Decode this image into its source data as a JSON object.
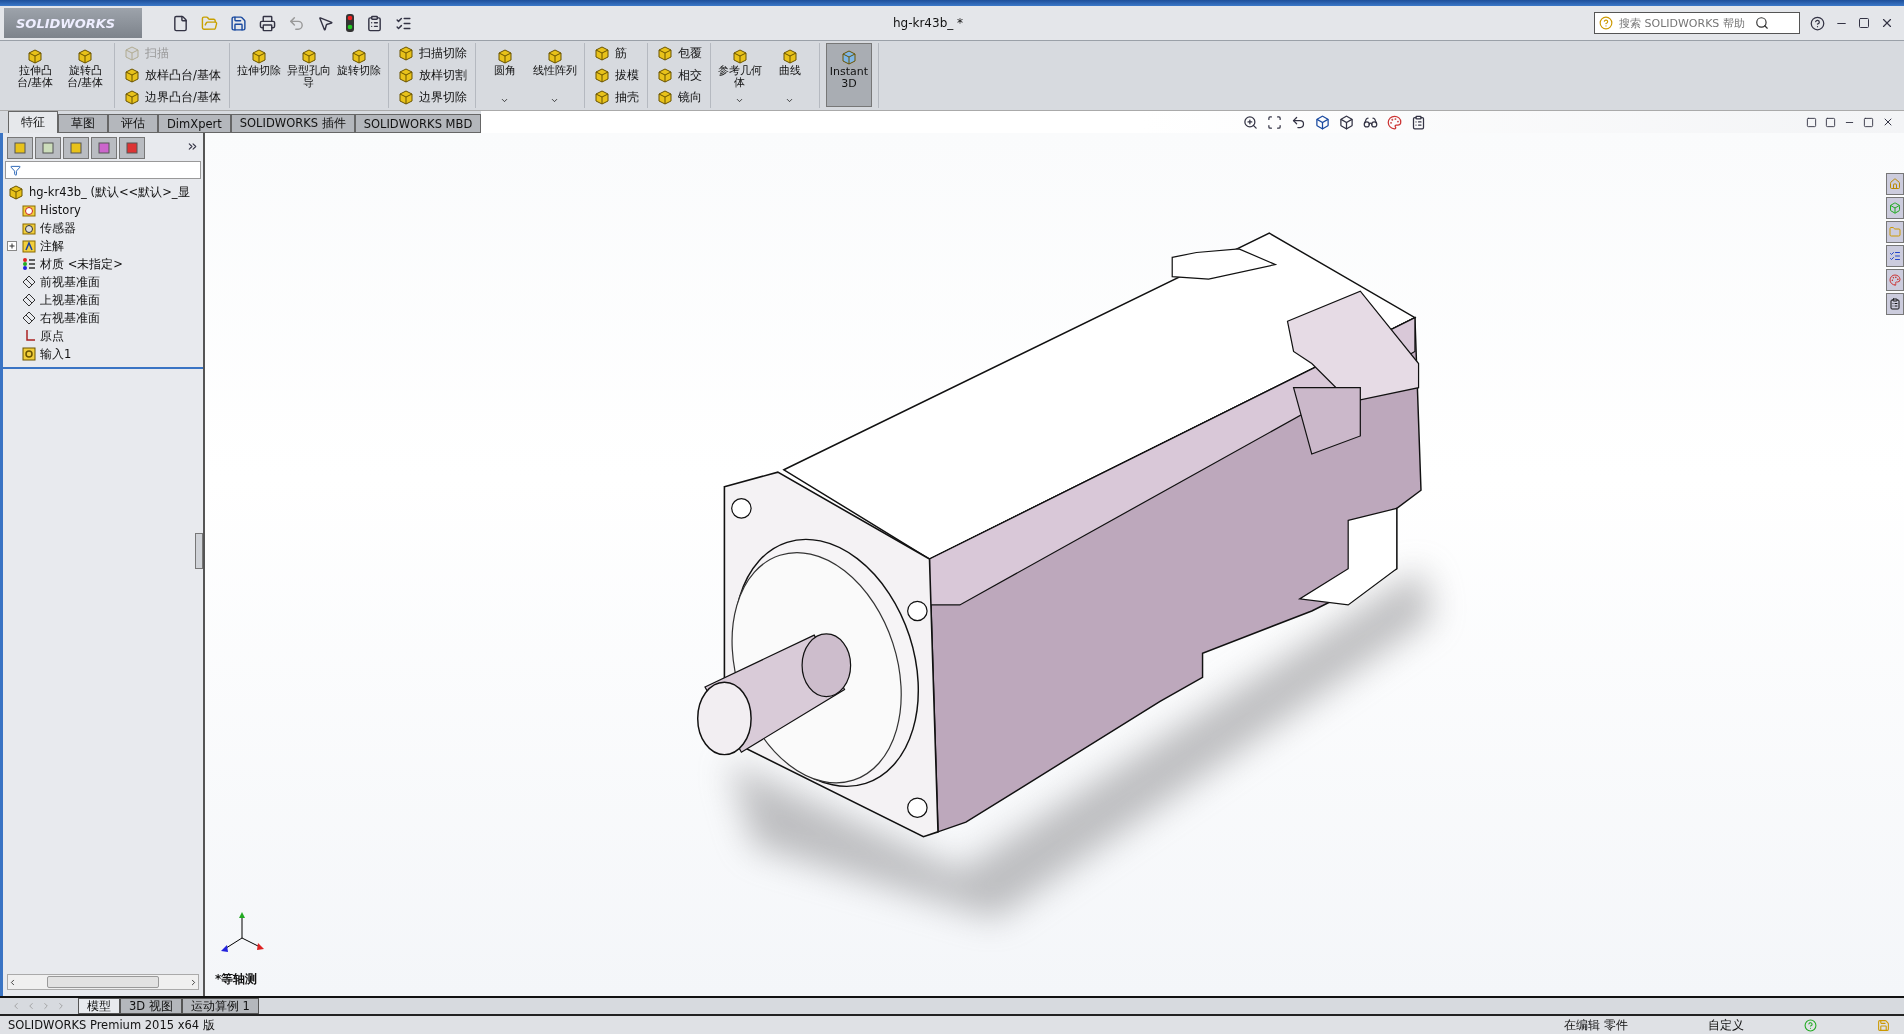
{
  "app": {
    "logo": "SOLIDWORKS",
    "document_title": "hg-kr43b_ *",
    "search": {
      "placeholder": "搜索 SOLIDWORKS 帮助"
    }
  },
  "ribbon": {
    "groups": [
      {
        "kind": "large",
        "items": [
          {
            "label": "拉伸凸台/基体",
            "dropdown": false,
            "selected": false
          },
          {
            "label": "旋转凸台/基体",
            "dropdown": false,
            "selected": false
          }
        ]
      },
      {
        "kind": "stack",
        "items": [
          {
            "label": "扫描",
            "disabled": true
          },
          {
            "label": "放样凸台/基体",
            "disabled": false
          },
          {
            "label": "边界凸台/基体",
            "disabled": false
          }
        ]
      },
      {
        "kind": "large",
        "items": [
          {
            "label": "拉伸切除",
            "dropdown": false,
            "selected": false
          },
          {
            "label": "异型孔向导",
            "dropdown": false,
            "selected": false
          },
          {
            "label": "旋转切除",
            "dropdown": false,
            "selected": false
          }
        ]
      },
      {
        "kind": "stack",
        "items": [
          {
            "label": "扫描切除",
            "disabled": false
          },
          {
            "label": "放样切割",
            "disabled": false
          },
          {
            "label": "边界切除",
            "disabled": false
          }
        ]
      },
      {
        "kind": "large",
        "items": [
          {
            "label": "圆角",
            "dropdown": true,
            "selected": false
          },
          {
            "label": "线性阵列",
            "dropdown": true,
            "selected": false
          }
        ]
      },
      {
        "kind": "stack",
        "items": [
          {
            "label": "筋",
            "disabled": false
          },
          {
            "label": "拔模",
            "disabled": false
          },
          {
            "label": "抽壳",
            "disabled": false
          }
        ]
      },
      {
        "kind": "stack",
        "items": [
          {
            "label": "包覆",
            "disabled": false
          },
          {
            "label": "相交",
            "disabled": false
          },
          {
            "label": "镜向",
            "disabled": false
          }
        ]
      },
      {
        "kind": "large",
        "items": [
          {
            "label": "参考几何体",
            "dropdown": true,
            "selected": false
          },
          {
            "label": "曲线",
            "dropdown": true,
            "selected": false
          }
        ]
      },
      {
        "kind": "large",
        "items": [
          {
            "label": "Instant3D",
            "dropdown": false,
            "selected": true
          }
        ]
      }
    ]
  },
  "command_tabs": [
    {
      "label": "特征",
      "selected": true
    },
    {
      "label": "草图",
      "selected": false
    },
    {
      "label": "评估",
      "selected": false
    },
    {
      "label": "DimXpert",
      "selected": false
    },
    {
      "label": "SOLIDWORKS 插件",
      "selected": false
    },
    {
      "label": "SOLIDWORKS MBD",
      "selected": false
    }
  ],
  "feature_tree": {
    "root": "hg-kr43b_  (默认<<默认>_显",
    "items": [
      {
        "kind": "history",
        "label": "History",
        "collapsed": false
      },
      {
        "kind": "sensor",
        "label": "传感器",
        "collapsed": false
      },
      {
        "kind": "annotation",
        "label": "注解",
        "collapsed": true
      },
      {
        "kind": "material",
        "label": "材质 <未指定>",
        "collapsed": false
      },
      {
        "kind": "plane",
        "label": "前视基准面",
        "collapsed": false
      },
      {
        "kind": "plane",
        "label": "上视基准面",
        "collapsed": false
      },
      {
        "kind": "plane",
        "label": "右视基准面",
        "collapsed": false
      },
      {
        "kind": "origin",
        "label": "原点",
        "collapsed": false
      },
      {
        "kind": "import",
        "label": "输入1",
        "collapsed": false
      }
    ]
  },
  "viewport": {
    "view_label": "*等轴测"
  },
  "bottom_tabs": [
    {
      "label": "模型",
      "selected": true
    },
    {
      "label": "3D 视图",
      "selected": false
    },
    {
      "label": "运动算例 1",
      "selected": false
    }
  ],
  "status_bar": {
    "product": "SOLIDWORKS Premium 2015 x64 版",
    "mode": "在编辑 零件",
    "units": "自定义"
  }
}
